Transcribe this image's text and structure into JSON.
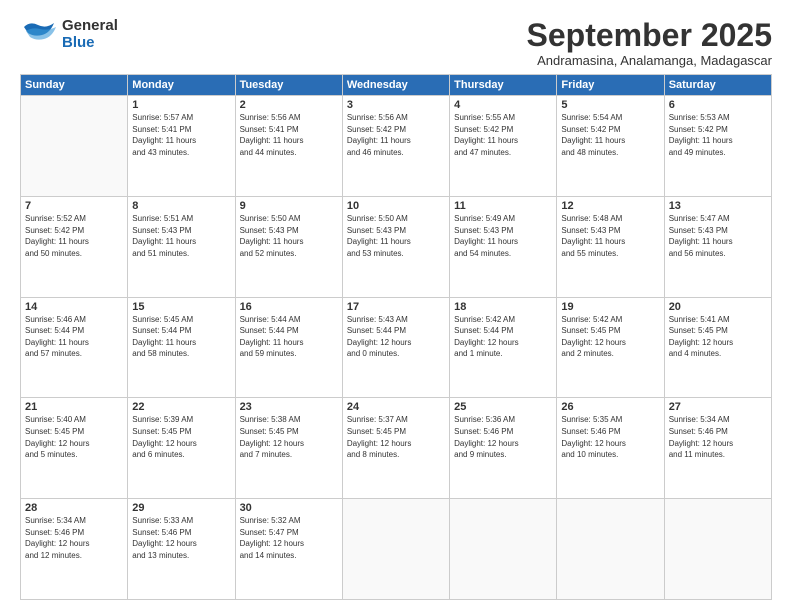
{
  "header": {
    "logo": {
      "line1": "General",
      "line2": "Blue"
    },
    "month": "September 2025",
    "location": "Andramasina, Analamanga, Madagascar"
  },
  "weekdays": [
    "Sunday",
    "Monday",
    "Tuesday",
    "Wednesday",
    "Thursday",
    "Friday",
    "Saturday"
  ],
  "weeks": [
    [
      {
        "day": "",
        "info": ""
      },
      {
        "day": "1",
        "info": "Sunrise: 5:57 AM\nSunset: 5:41 PM\nDaylight: 11 hours\nand 43 minutes."
      },
      {
        "day": "2",
        "info": "Sunrise: 5:56 AM\nSunset: 5:41 PM\nDaylight: 11 hours\nand 44 minutes."
      },
      {
        "day": "3",
        "info": "Sunrise: 5:56 AM\nSunset: 5:42 PM\nDaylight: 11 hours\nand 46 minutes."
      },
      {
        "day": "4",
        "info": "Sunrise: 5:55 AM\nSunset: 5:42 PM\nDaylight: 11 hours\nand 47 minutes."
      },
      {
        "day": "5",
        "info": "Sunrise: 5:54 AM\nSunset: 5:42 PM\nDaylight: 11 hours\nand 48 minutes."
      },
      {
        "day": "6",
        "info": "Sunrise: 5:53 AM\nSunset: 5:42 PM\nDaylight: 11 hours\nand 49 minutes."
      }
    ],
    [
      {
        "day": "7",
        "info": "Sunrise: 5:52 AM\nSunset: 5:42 PM\nDaylight: 11 hours\nand 50 minutes."
      },
      {
        "day": "8",
        "info": "Sunrise: 5:51 AM\nSunset: 5:43 PM\nDaylight: 11 hours\nand 51 minutes."
      },
      {
        "day": "9",
        "info": "Sunrise: 5:50 AM\nSunset: 5:43 PM\nDaylight: 11 hours\nand 52 minutes."
      },
      {
        "day": "10",
        "info": "Sunrise: 5:50 AM\nSunset: 5:43 PM\nDaylight: 11 hours\nand 53 minutes."
      },
      {
        "day": "11",
        "info": "Sunrise: 5:49 AM\nSunset: 5:43 PM\nDaylight: 11 hours\nand 54 minutes."
      },
      {
        "day": "12",
        "info": "Sunrise: 5:48 AM\nSunset: 5:43 PM\nDaylight: 11 hours\nand 55 minutes."
      },
      {
        "day": "13",
        "info": "Sunrise: 5:47 AM\nSunset: 5:43 PM\nDaylight: 11 hours\nand 56 minutes."
      }
    ],
    [
      {
        "day": "14",
        "info": "Sunrise: 5:46 AM\nSunset: 5:44 PM\nDaylight: 11 hours\nand 57 minutes."
      },
      {
        "day": "15",
        "info": "Sunrise: 5:45 AM\nSunset: 5:44 PM\nDaylight: 11 hours\nand 58 minutes."
      },
      {
        "day": "16",
        "info": "Sunrise: 5:44 AM\nSunset: 5:44 PM\nDaylight: 11 hours\nand 59 minutes."
      },
      {
        "day": "17",
        "info": "Sunrise: 5:43 AM\nSunset: 5:44 PM\nDaylight: 12 hours\nand 0 minutes."
      },
      {
        "day": "18",
        "info": "Sunrise: 5:42 AM\nSunset: 5:44 PM\nDaylight: 12 hours\nand 1 minute."
      },
      {
        "day": "19",
        "info": "Sunrise: 5:42 AM\nSunset: 5:45 PM\nDaylight: 12 hours\nand 2 minutes."
      },
      {
        "day": "20",
        "info": "Sunrise: 5:41 AM\nSunset: 5:45 PM\nDaylight: 12 hours\nand 4 minutes."
      }
    ],
    [
      {
        "day": "21",
        "info": "Sunrise: 5:40 AM\nSunset: 5:45 PM\nDaylight: 12 hours\nand 5 minutes."
      },
      {
        "day": "22",
        "info": "Sunrise: 5:39 AM\nSunset: 5:45 PM\nDaylight: 12 hours\nand 6 minutes."
      },
      {
        "day": "23",
        "info": "Sunrise: 5:38 AM\nSunset: 5:45 PM\nDaylight: 12 hours\nand 7 minutes."
      },
      {
        "day": "24",
        "info": "Sunrise: 5:37 AM\nSunset: 5:45 PM\nDaylight: 12 hours\nand 8 minutes."
      },
      {
        "day": "25",
        "info": "Sunrise: 5:36 AM\nSunset: 5:46 PM\nDaylight: 12 hours\nand 9 minutes."
      },
      {
        "day": "26",
        "info": "Sunrise: 5:35 AM\nSunset: 5:46 PM\nDaylight: 12 hours\nand 10 minutes."
      },
      {
        "day": "27",
        "info": "Sunrise: 5:34 AM\nSunset: 5:46 PM\nDaylight: 12 hours\nand 11 minutes."
      }
    ],
    [
      {
        "day": "28",
        "info": "Sunrise: 5:34 AM\nSunset: 5:46 PM\nDaylight: 12 hours\nand 12 minutes."
      },
      {
        "day": "29",
        "info": "Sunrise: 5:33 AM\nSunset: 5:46 PM\nDaylight: 12 hours\nand 13 minutes."
      },
      {
        "day": "30",
        "info": "Sunrise: 5:32 AM\nSunset: 5:47 PM\nDaylight: 12 hours\nand 14 minutes."
      },
      {
        "day": "",
        "info": ""
      },
      {
        "day": "",
        "info": ""
      },
      {
        "day": "",
        "info": ""
      },
      {
        "day": "",
        "info": ""
      }
    ]
  ]
}
